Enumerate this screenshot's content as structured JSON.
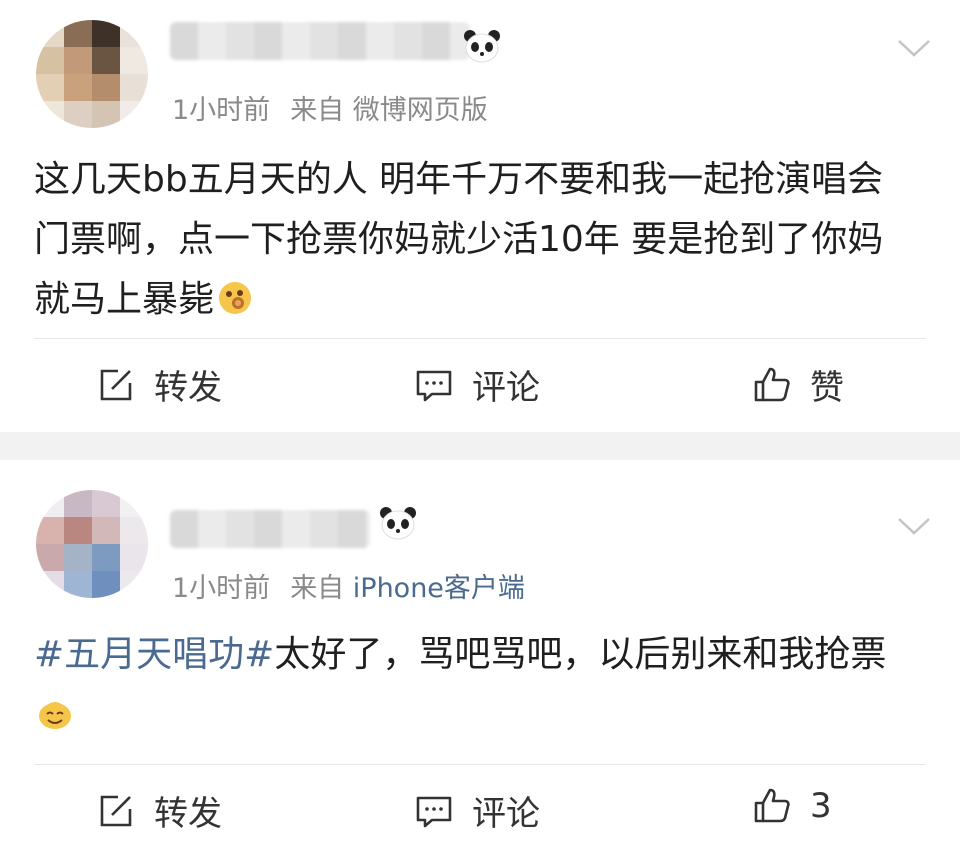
{
  "posts": [
    {
      "time": "1小时前",
      "from": "来自",
      "source": "微博网页版",
      "content": "这几天bb五月天的人 明年千万不要和我一起抢演唱会门票啊，点一下抢票你妈就少活10年 要是抢到了你妈就马上暴毙",
      "actions": {
        "repost": "转发",
        "comment": "评论",
        "like": "赞"
      }
    },
    {
      "time": "1小时前",
      "from": "来自",
      "source": "iPhone客户端",
      "hashtag": "#五月天唱功#",
      "content": "太好了，骂吧骂吧，以后别来和我抢票",
      "actions": {
        "repost": "转发",
        "comment": "评论",
        "like": "3"
      }
    }
  ],
  "colors": {
    "link": "#4b6a8f",
    "meta": "#8a8a8a",
    "separator": "#f2f2f2"
  }
}
